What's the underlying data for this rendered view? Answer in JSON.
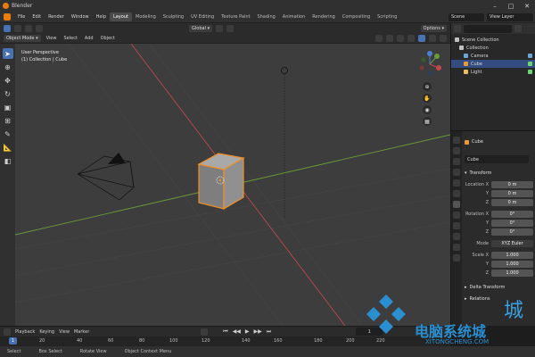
{
  "window": {
    "title": "Blender"
  },
  "menubar": {
    "menus": [
      "File",
      "Edit",
      "Render",
      "Window",
      "Help"
    ],
    "workspaces": [
      "Layout",
      "Modeling",
      "Sculpting",
      "UV Editing",
      "Texture Paint",
      "Shading",
      "Animation",
      "Rendering",
      "Compositing",
      "Scripting"
    ],
    "active_workspace": "Layout",
    "scene": "Scene",
    "view_layer": "View Layer"
  },
  "viewport_header": {
    "mode": "Object Mode",
    "menus": [
      "View",
      "Select",
      "Add",
      "Object"
    ],
    "orientation": "Global",
    "options": "Options"
  },
  "viewport": {
    "perspective": "User Perspective",
    "collection": "(1) Collection | Cube"
  },
  "outliner": {
    "title": "Scene Collection",
    "items": [
      {
        "label": "Collection",
        "color": "#c0c0c0"
      },
      {
        "label": "Camera",
        "color": "#6aa4d8"
      },
      {
        "label": "Cube",
        "color": "#e89a3a"
      },
      {
        "label": "Light",
        "color": "#e8c05a"
      }
    ]
  },
  "properties": {
    "object_name": "Cube",
    "datablock": "Cube",
    "transform_label": "Transform",
    "location": {
      "label": "Location X",
      "x": "0 m",
      "y": "0 m",
      "z": "0 m"
    },
    "rotation": {
      "label": "Rotation X",
      "x": "0°",
      "y": "0°",
      "z": "0°"
    },
    "mode_label": "Mode",
    "mode_value": "XYZ Euler",
    "scale": {
      "label": "Scale X",
      "x": "1.000",
      "y": "1.000",
      "z": "1.000"
    },
    "delta_transform": "Delta Transform",
    "relations": "Relations",
    "y_label": "Y",
    "z_label": "Z"
  },
  "timeline": {
    "menus": [
      "Playback",
      "Keying",
      "View",
      "Marker"
    ],
    "current_frame": "1",
    "frame_field": "1",
    "frames": [
      "1",
      "20",
      "40",
      "60",
      "80",
      "100",
      "120",
      "140",
      "160",
      "180",
      "200",
      "220"
    ]
  },
  "statusbar": {
    "items": [
      "Select",
      "Box Select",
      "Rotate View",
      "Object Context Menu"
    ]
  },
  "watermark": {
    "brand": "电脑系统城",
    "url": "XITONGCHENG.COM",
    "side": "城"
  },
  "colors": {
    "accent": "#4772b3",
    "orange": "#e87d0d",
    "axis_x": "#b94a4a",
    "axis_y": "#6a9b3a"
  }
}
